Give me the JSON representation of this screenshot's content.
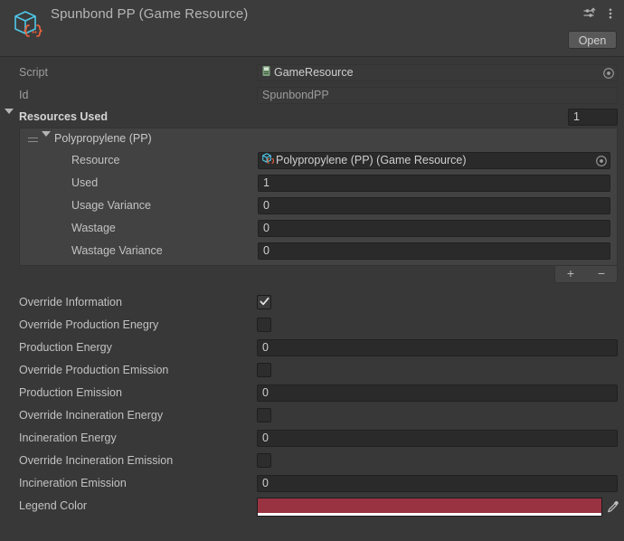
{
  "header": {
    "title": "Spunbond PP (Game Resource)",
    "icon": "scriptable-object-icon",
    "preset_icon": "preset-icon",
    "menu_icon": "kebab-menu-icon",
    "open_label": "Open"
  },
  "script_row": {
    "label": "Script",
    "value": "GameResource",
    "icon": "cs-script-icon",
    "picker_icon": "object-picker-icon"
  },
  "id_row": {
    "label": "Id",
    "value": "SpunbondPP"
  },
  "resources_used": {
    "label": "Resources Used",
    "size": "1",
    "foldout_icon": "chevron-down-icon",
    "element": {
      "name": "Polypropylene (PP)",
      "drag_icon": "drag-handle-icon",
      "foldout_icon": "chevron-down-icon",
      "fields": [
        {
          "label": "Resource",
          "value": "Polypropylene (PP) (Game Resource)",
          "type": "object",
          "icon": "scriptable-object-icon",
          "picker_icon": "object-picker-icon"
        },
        {
          "label": "Used",
          "value": "1",
          "type": "number"
        },
        {
          "label": "Usage Variance",
          "value": "0",
          "type": "number"
        },
        {
          "label": "Wastage",
          "value": "0",
          "type": "number"
        },
        {
          "label": "Wastage Variance",
          "value": "0",
          "type": "number"
        }
      ]
    },
    "add_label": "+",
    "remove_label": "−"
  },
  "properties": [
    {
      "label": "Override Information",
      "type": "checkbox",
      "checked": true
    },
    {
      "label": "Override Production Enegry",
      "type": "checkbox",
      "checked": false
    },
    {
      "label": "Production Energy",
      "type": "number",
      "value": "0"
    },
    {
      "label": "Override Production Emission",
      "type": "checkbox",
      "checked": false
    },
    {
      "label": "Production Emission",
      "type": "number",
      "value": "0"
    },
    {
      "label": "Override Incineration Energy",
      "type": "checkbox",
      "checked": false
    },
    {
      "label": "Incineration Energy",
      "type": "number",
      "value": "0"
    },
    {
      "label": "Override Incineration Emission",
      "type": "checkbox",
      "checked": false
    },
    {
      "label": "Incineration Emission",
      "type": "number",
      "value": "0"
    }
  ],
  "legend_color": {
    "label": "Legend Color",
    "value": "#9A3341",
    "alpha_color": "#FFFFFF",
    "eyedropper_icon": "eyedropper-icon"
  }
}
